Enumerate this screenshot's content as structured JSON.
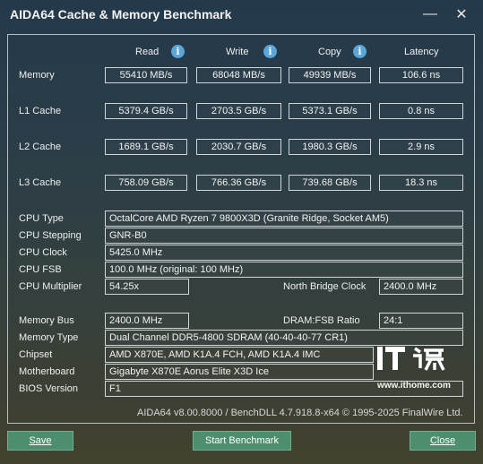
{
  "window": {
    "title": "AIDA64 Cache & Memory Benchmark",
    "minimize_icon": "minimize-icon",
    "close_icon": "close-icon"
  },
  "columns": [
    "Read",
    "Write",
    "Copy",
    "Latency"
  ],
  "rows": [
    {
      "label": "Memory",
      "read": "55410 MB/s",
      "write": "68048 MB/s",
      "copy": "49939 MB/s",
      "latency": "106.6 ns"
    },
    {
      "label": "L1 Cache",
      "read": "5379.4 GB/s",
      "write": "2703.5 GB/s",
      "copy": "5373.1 GB/s",
      "latency": "0.8 ns"
    },
    {
      "label": "L2 Cache",
      "read": "1689.1 GB/s",
      "write": "2030.7 GB/s",
      "copy": "1980.3 GB/s",
      "latency": "2.9 ns"
    },
    {
      "label": "L3 Cache",
      "read": "758.09 GB/s",
      "write": "766.36 GB/s",
      "copy": "739.68 GB/s",
      "latency": "18.3 ns"
    }
  ],
  "cpu": {
    "type_label": "CPU Type",
    "type": "OctalCore AMD Ryzen 7 9800X3D  (Granite Ridge, Socket AM5)",
    "stepping_label": "CPU Stepping",
    "stepping": "GNR-B0",
    "clock_label": "CPU Clock",
    "clock": "5425.0 MHz",
    "fsb_label": "CPU FSB",
    "fsb": "100.0 MHz  (original: 100 MHz)",
    "multiplier_label": "CPU Multiplier",
    "multiplier": "54.25x",
    "nb_clock_label": "North Bridge Clock",
    "nb_clock": "2400.0 MHz"
  },
  "memory": {
    "bus_label": "Memory Bus",
    "bus": "2400.0 MHz",
    "ratio_label": "DRAM:FSB Ratio",
    "ratio": "24:1",
    "type_label": "Memory Type",
    "type": "Dual Channel DDR5-4800 SDRAM  (40-40-40-77 CR1)",
    "chipset_label": "Chipset",
    "chipset": "AMD X870E, AMD K1A.4 FCH, AMD K1A.4 IMC",
    "motherboard_label": "Motherboard",
    "motherboard": "Gigabyte X870E Aorus Elite X3D Ice",
    "bios_label": "BIOS Version",
    "bios": "F1"
  },
  "footer": "AIDA64 v8.00.8000 / BenchDLL 4.7.918.8-x64  © 1995-2025 FinalWire Ltd.",
  "buttons": {
    "save": "Save",
    "start": "Start Benchmark",
    "close": "Close"
  },
  "watermark": {
    "url": "www.ithome.com"
  },
  "colors": {
    "info_icon": "#5aa6d8",
    "button_bg": "#4c8e6e"
  }
}
